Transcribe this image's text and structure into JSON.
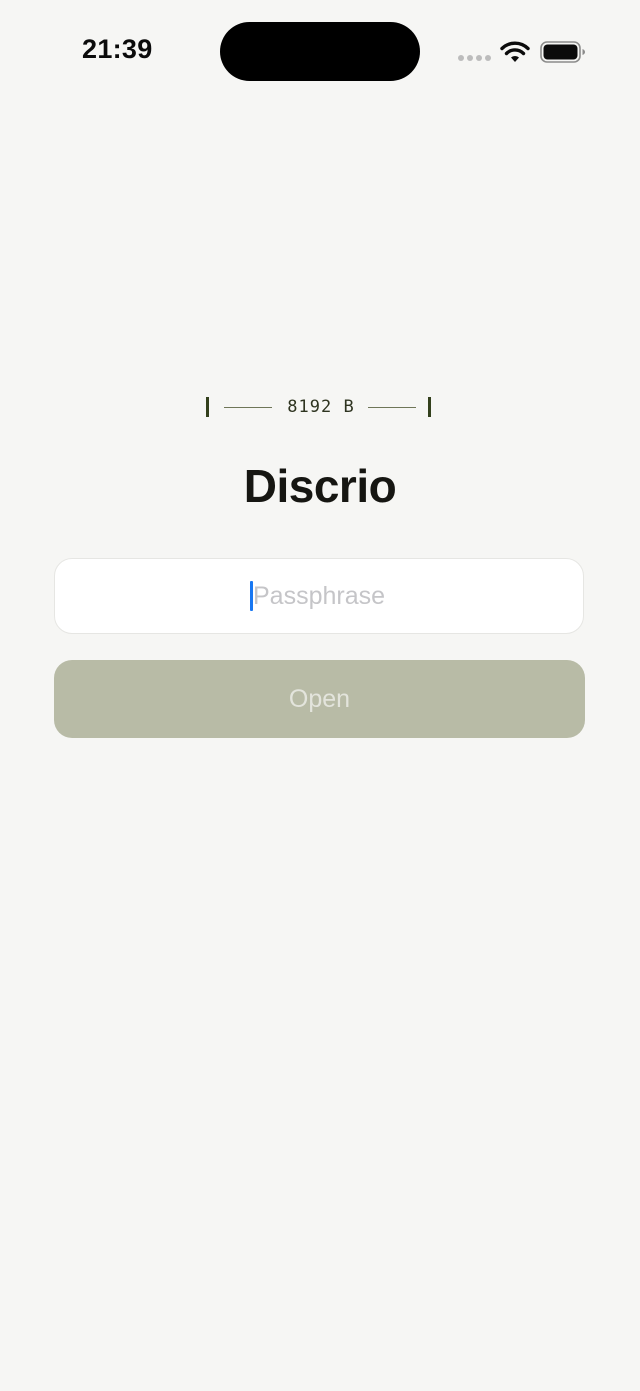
{
  "status_bar": {
    "time": "21:39",
    "icons": [
      "cellular-signal-icon",
      "wifi-icon",
      "battery-icon"
    ]
  },
  "size_marker": {
    "label": "8192 B"
  },
  "app": {
    "title": "Discrio"
  },
  "passphrase": {
    "value": "",
    "placeholder": "Passphrase"
  },
  "open_button": {
    "label": "Open",
    "enabled": false
  },
  "colors": {
    "background": "#f6f6f4",
    "button_disabled": "#b8bba6",
    "cursor": "#1877f2",
    "accent_dark": "#33401c"
  }
}
